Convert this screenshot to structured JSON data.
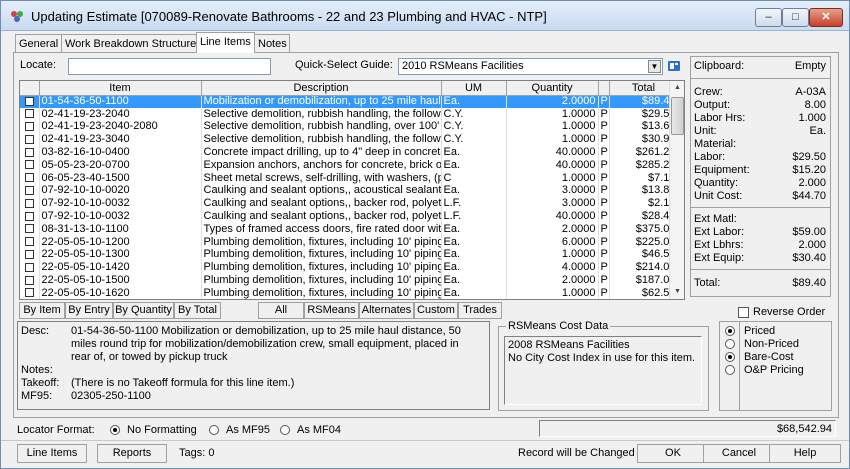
{
  "window": {
    "title": "Updating Estimate [070089-Renovate Bathrooms - 22 and 23 Plumbing and HVAC - NTP]",
    "minimize": "–",
    "maximize": "□",
    "close": "✕"
  },
  "tabs": [
    "General",
    "Work Breakdown Structure",
    "Line Items",
    "Notes"
  ],
  "locate": {
    "label": "Locate:",
    "value": ""
  },
  "quick_select": {
    "label": "Quick-Select Guide:",
    "value": "2010 RSMeans Facilities"
  },
  "grid": {
    "columns": [
      "Item",
      "Description",
      "UM",
      "Quantity",
      "Total"
    ],
    "rows": [
      {
        "item": "01-54-36-50-1100",
        "desc": "Mobilization or demobilization, up to 25 mile haul d",
        "um": "Ea.",
        "qty": "2.0000",
        "p": "P",
        "total": "$89.40",
        "selected": true
      },
      {
        "item": "02-41-19-23-2040",
        "desc": "Selective demolition, rubbish handling, the followin",
        "um": "C.Y.",
        "qty": "1.0000",
        "p": "P",
        "total": "$29.50"
      },
      {
        "item": "02-41-19-23-2040-2080",
        "desc": "Selective demolition, rubbish handling, over 100' h",
        "um": "C.Y.",
        "qty": "1.0000",
        "p": "P",
        "total": "$13.65"
      },
      {
        "item": "02-41-19-23-3040",
        "desc": "Selective demolition, rubbish handling, the followin",
        "um": "C.Y.",
        "qty": "1.0000",
        "p": "P",
        "total": "$30.95"
      },
      {
        "item": "03-82-16-10-0400",
        "desc": "Concrete impact drilling, up to 4\" deep in concrete,",
        "um": "Ea.",
        "qty": "40.0000",
        "p": "P",
        "total": "$261.20"
      },
      {
        "item": "05-05-23-20-0700",
        "desc": "Expansion anchors, anchors for concrete, brick or s",
        "um": "Ea.",
        "qty": "40.0000",
        "p": "P",
        "total": "$285.20"
      },
      {
        "item": "06-05-23-40-1500",
        "desc": "Sheet metal screws, self-drilling, with washers, (pin",
        "um": "C",
        "qty": "1.0000",
        "p": "P",
        "total": "$7.10"
      },
      {
        "item": "07-92-10-10-0020",
        "desc": "Caulking and sealant options,, acoustical sealant,",
        "um": "Ea.",
        "qty": "3.0000",
        "p": "P",
        "total": "$13.80"
      },
      {
        "item": "07-92-10-10-0032",
        "desc": "Caulking and sealant options,, backer rod, polyeth",
        "um": "L.F.",
        "qty": "3.0000",
        "p": "P",
        "total": "$2.13"
      },
      {
        "item": "07-92-10-10-0032",
        "desc": "Caulking and sealant options,, backer rod, polyeth",
        "um": "L.F.",
        "qty": "40.0000",
        "p": "P",
        "total": "$28.40"
      },
      {
        "item": "08-31-13-10-1100",
        "desc": "Types of framed access doors, fire rated door with",
        "um": "Ea.",
        "qty": "2.0000",
        "p": "P",
        "total": "$375.00"
      },
      {
        "item": "22-05-05-10-1200",
        "desc": "Plumbing demolition, fixtures, including 10' piping,",
        "um": "Ea.",
        "qty": "6.0000",
        "p": "P",
        "total": "$225.00"
      },
      {
        "item": "22-05-05-10-1300",
        "desc": "Plumbing demolition, fixtures, including 10' piping,",
        "um": "Ea.",
        "qty": "1.0000",
        "p": "P",
        "total": "$46.50"
      },
      {
        "item": "22-05-05-10-1420",
        "desc": "Plumbing demolition, fixtures, including 10' piping,",
        "um": "Ea.",
        "qty": "4.0000",
        "p": "P",
        "total": "$214.00"
      },
      {
        "item": "22-05-05-10-1500",
        "desc": "Plumbing demolition, fixtures, including 10' piping,",
        "um": "Ea.",
        "qty": "2.0000",
        "p": "P",
        "total": "$187.00"
      },
      {
        "item": "22-05-05-10-1620",
        "desc": "Plumbing demolition, fixtures, including 10' piping,",
        "um": "Ea.",
        "qty": "1.0000",
        "p": "P",
        "total": "$62.50"
      }
    ]
  },
  "clipboard": {
    "label": "Clipboard:",
    "status": "Empty",
    "crew": [
      "Crew:",
      "A-03A"
    ],
    "output": [
      "Output:",
      "8.00"
    ],
    "labor_hrs": [
      "Labor Hrs:",
      "1.000"
    ],
    "unit": [
      "Unit:",
      "Ea."
    ],
    "material": [
      "Material:",
      ""
    ],
    "labor": [
      "Labor:",
      "$29.50"
    ],
    "equipment": [
      "Equipment:",
      "$15.20"
    ],
    "quantity": [
      "Quantity:",
      "2.000"
    ],
    "unit_cost": [
      "Unit Cost:",
      "$44.70"
    ],
    "ext_matl": [
      "Ext Matl:",
      ""
    ],
    "ext_labor": [
      "Ext Labor:",
      "$59.00"
    ],
    "ext_lbhrs": [
      "Ext Lbhrs:",
      "2.000"
    ],
    "ext_equip": [
      "Ext Equip:",
      "$30.40"
    ],
    "total": [
      "Total:",
      "$89.40"
    ]
  },
  "sort_tabs": [
    "By Item",
    "By Entry",
    "By Quantity",
    "By Total"
  ],
  "filter_tabs": [
    "All",
    "RSMeans",
    "Alternates",
    "Custom",
    "Trades"
  ],
  "reverse_order": "Reverse Order",
  "details": {
    "desc_label": "Desc:",
    "desc_lines": [
      "01-54-36-50-1100 Mobilization or demobilization, up to 25 mile haul distance, 50",
      "miles round trip for mobilization/demobilization crew, small equipment, placed in",
      "rear of, or towed by pickup truck"
    ],
    "notes_label": "Notes:",
    "takeoff_label": "Takeoff:",
    "takeoff_value": "(There is no Takeoff formula for this line item.)",
    "mf95_label": "MF95:",
    "mf95_value": "02305-250-1100"
  },
  "cost_data": {
    "legend": "RSMeans Cost Data",
    "line1": "2008 RSMeans Facilities",
    "line2": "No City Cost Index in use for this item."
  },
  "pricing": {
    "priced": "Priced",
    "non_priced": "Non-Priced",
    "bare_cost": "Bare-Cost",
    "op_pricing": "O&P Pricing"
  },
  "locator_format": {
    "label": "Locator Format:",
    "options": [
      "No Formatting",
      "As MF95",
      "As MF04"
    ]
  },
  "grand_total": "$68,542.94",
  "bottom": {
    "line_items": "Line Items",
    "reports": "Reports",
    "tags": "Tags: 0",
    "record_changed": "Record will be Changed",
    "ok": "OK",
    "cancel": "Cancel",
    "help": "Help"
  },
  "colors": {
    "selection": "#3399ff",
    "titlebar": "#c9dbf1",
    "close_button": "#c4412b"
  },
  "icons": [
    "app-icon",
    "minimize-icon",
    "maximize-icon",
    "close-icon",
    "book-icon",
    "dropdown-arrow-icon",
    "scroll-up-icon",
    "scroll-down-icon"
  ]
}
